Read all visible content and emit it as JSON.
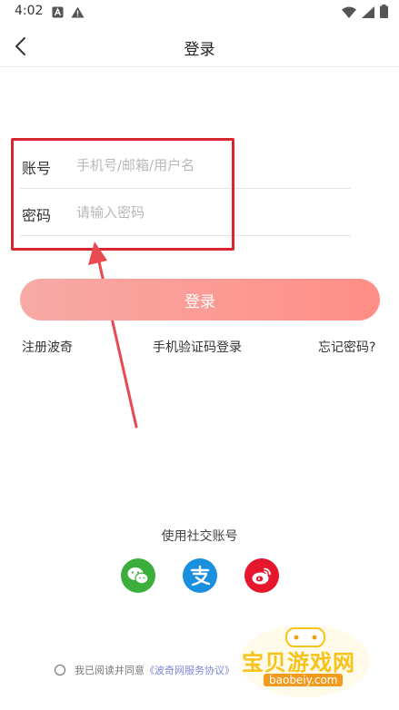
{
  "status_bar": {
    "time": "4:02",
    "icons_left": [
      "a-box-icon",
      "warning-icon"
    ],
    "icons_right": [
      "wifi-icon",
      "signal-icon",
      "battery-icon"
    ]
  },
  "app_bar": {
    "back_icon": "chevron-left-icon",
    "title": "登录"
  },
  "form": {
    "account_label": "账号",
    "account_placeholder": "手机号/邮箱/用户名",
    "account_value": "",
    "password_label": "密码",
    "password_placeholder": "请输入密码",
    "password_value": ""
  },
  "login_button": {
    "label": "登录"
  },
  "links": {
    "register": "注册波奇",
    "sms_login": "手机验证码登录",
    "forgot_password": "忘记密码?"
  },
  "social": {
    "title": "使用社交账号",
    "providers": [
      {
        "name": "wechat-icon",
        "color": "#3cae3c"
      },
      {
        "name": "alipay-icon",
        "color": "#1a8fe0"
      },
      {
        "name": "weibo-icon",
        "color": "#e6162d"
      }
    ]
  },
  "agreement": {
    "prefix": "我已阅读并同意",
    "link": "《波奇网服务协议》"
  },
  "watermark": {
    "text": "宝贝游戏网",
    "url": "baobeiy.com"
  },
  "colors": {
    "highlight": "#d7262e",
    "button_start": "#f7aaa6",
    "button_end": "#ff8e86",
    "link": "#7d86d8"
  }
}
